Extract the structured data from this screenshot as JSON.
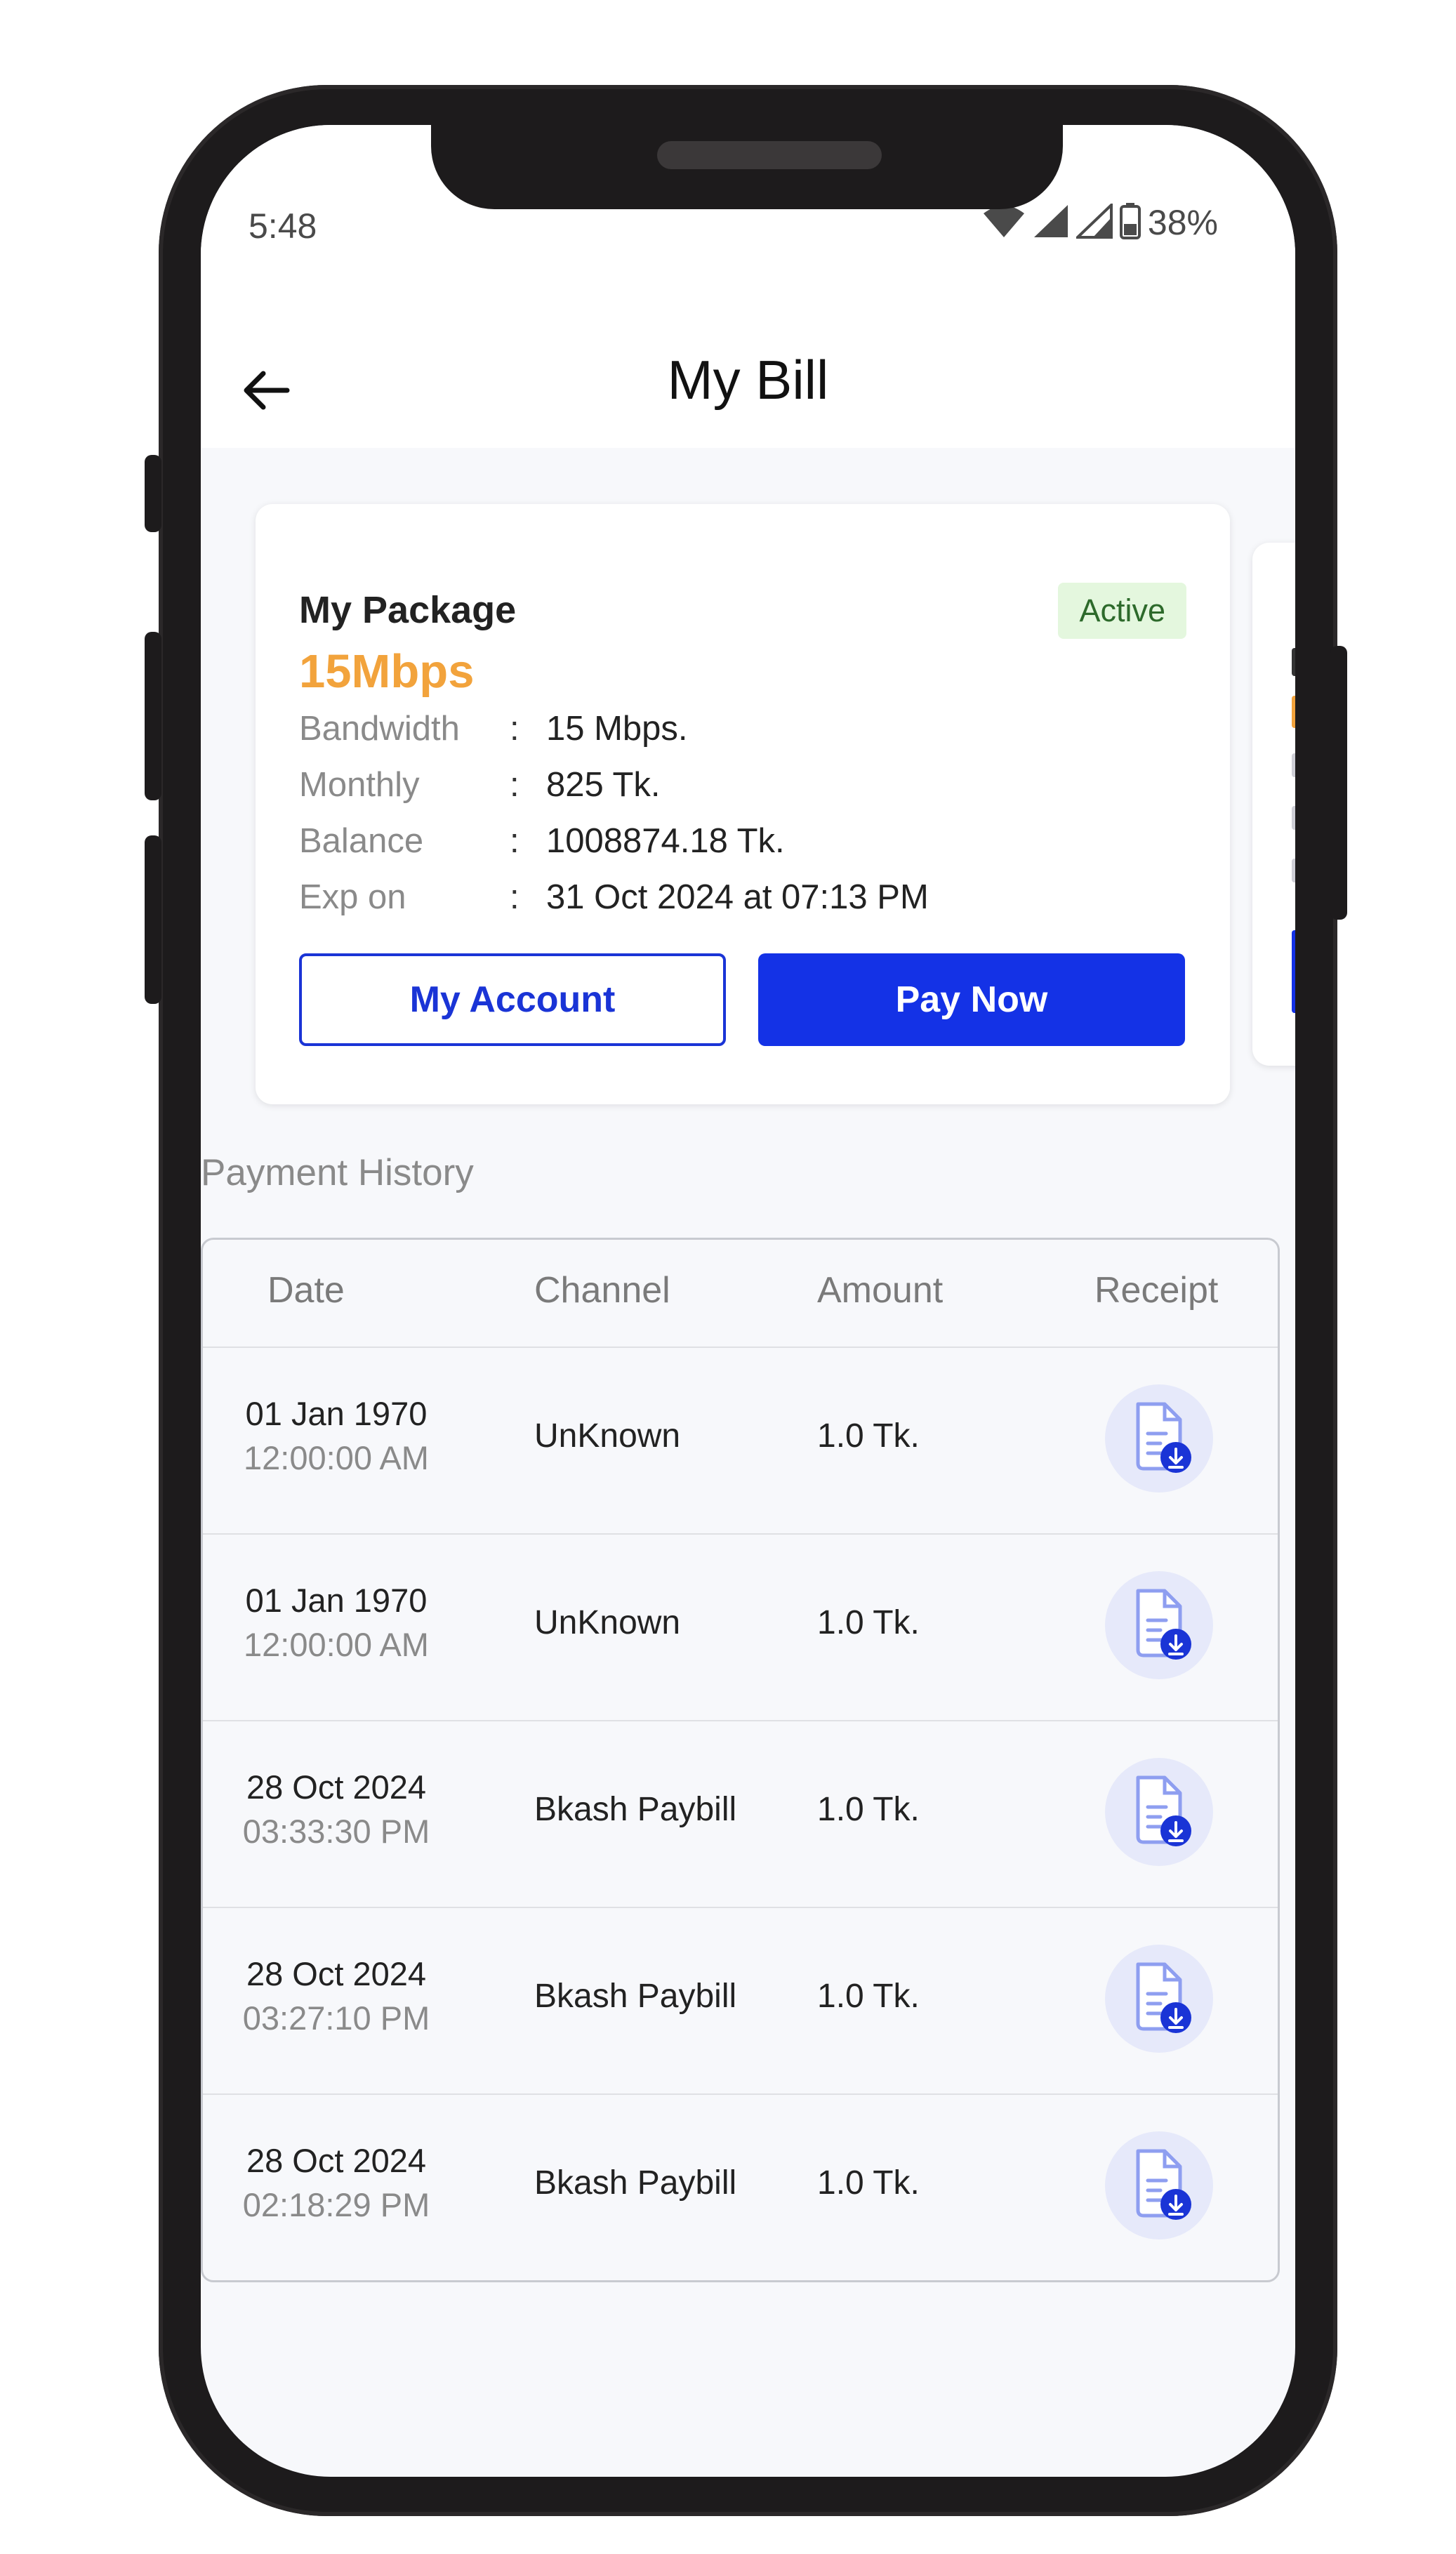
{
  "status_bar": {
    "time": "5:48",
    "battery": "38%"
  },
  "header": {
    "title": "My Bill"
  },
  "package": {
    "heading": "My Package",
    "status": "Active",
    "speed": "15Mbps",
    "rows": [
      {
        "label": "Bandwidth",
        "sep": ":",
        "value": "15 Mbps."
      },
      {
        "label": "Monthly",
        "sep": ":",
        "value": "825 Tk."
      },
      {
        "label": "Balance",
        "sep": ":",
        "value": "1008874.18 Tk."
      },
      {
        "label": "Exp on",
        "sep": ":",
        "value": "31 Oct 2024 at 07:13 PM"
      }
    ],
    "account_button": "My Account",
    "pay_button": "Pay Now"
  },
  "history": {
    "title": "Payment History",
    "columns": [
      "Date",
      "Channel",
      "Amount",
      "Receipt"
    ],
    "rows": [
      {
        "date": "01 Jan 1970",
        "time": "12:00:00 AM",
        "channel": "UnKnown",
        "amount": "1.0 Tk."
      },
      {
        "date": "01 Jan 1970",
        "time": "12:00:00 AM",
        "channel": "UnKnown",
        "amount": "1.0 Tk."
      },
      {
        "date": "28 Oct 2024",
        "time": "03:33:30 PM",
        "channel": "Bkash Paybill",
        "amount": "1.0 Tk."
      },
      {
        "date": "28 Oct 2024",
        "time": "03:27:10 PM",
        "channel": "Bkash Paybill",
        "amount": "1.0 Tk."
      },
      {
        "date": "28 Oct 2024",
        "time": "02:18:29 PM",
        "channel": "Bkash Paybill",
        "amount": "1.0 Tk."
      }
    ]
  },
  "colors": {
    "accent": "#1432e6",
    "speed": "#f2a33c",
    "badge_bg": "#e4f7de",
    "frame": "#1d1b1c"
  },
  "icons": {
    "back": "arrow-left-icon",
    "receipt": "receipt-download-icon",
    "wifi": "wifi-icon",
    "signal": "signal-icon",
    "battery": "battery-icon"
  }
}
